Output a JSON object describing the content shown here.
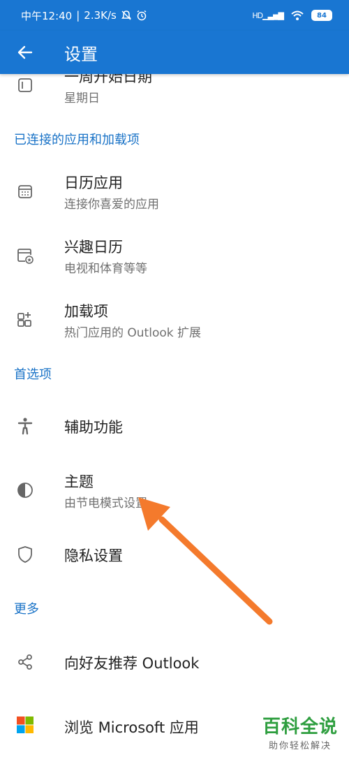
{
  "status_bar": {
    "time": "中午12:40",
    "speed": "2.3K/s",
    "battery": "84",
    "network": "HD"
  },
  "header": {
    "title": "设置"
  },
  "rows": {
    "week_start": {
      "title": "一周开始日期",
      "subtitle": "星期日"
    },
    "calendar_apps": {
      "title": "日历应用",
      "subtitle": "连接你喜爱的应用"
    },
    "interest_calendars": {
      "title": "兴趣日历",
      "subtitle": "电视和体育等等"
    },
    "addins": {
      "title": "加载项",
      "subtitle": "热门应用的 Outlook 扩展"
    },
    "accessibility": {
      "title": "辅助功能"
    },
    "theme": {
      "title": "主题",
      "subtitle": "由节电模式设置"
    },
    "privacy": {
      "title": "隐私设置"
    },
    "recommend": {
      "title": "向好友推荐 Outlook"
    },
    "microsoft_apps": {
      "title": "浏览 Microsoft 应用"
    }
  },
  "sections": {
    "connected": "已连接的应用和加载项",
    "preferences": "首选项",
    "more": "更多"
  },
  "watermark": {
    "main": "百科全说",
    "sub": "助你轻松解决"
  },
  "colors": {
    "primary": "#1976d2",
    "section": "#1a73c7",
    "annotation_arrow": "#f47a2c"
  }
}
